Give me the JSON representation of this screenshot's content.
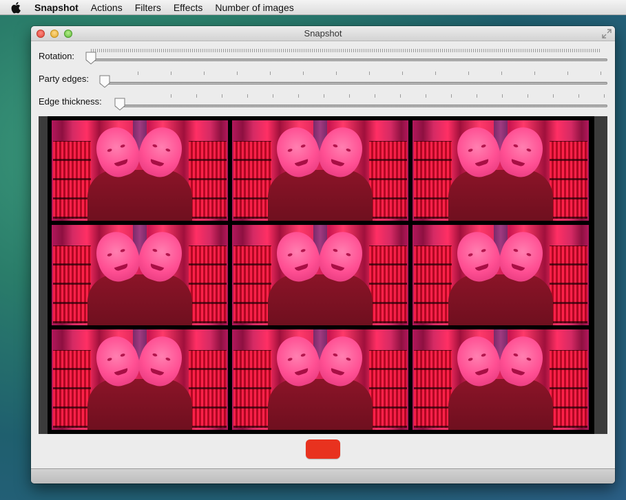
{
  "menubar": {
    "apple_icon": "apple-icon",
    "app_name": "Snapshot",
    "items": [
      "Actions",
      "Filters",
      "Effects",
      "Number of images"
    ]
  },
  "window": {
    "title": "Snapshot"
  },
  "controls": {
    "rotation_label": "Rotation:",
    "rotation_value": 0,
    "party_edges_label": "Party edges:",
    "party_edges_value": 0,
    "edge_thickness_label": "Edge thickness:",
    "edge_thickness_value": 0
  },
  "grid": {
    "rows": 3,
    "columns": 3,
    "tile_count": 9
  },
  "snapshot_button": {
    "color": "#e8321f"
  },
  "colors": {
    "accent": "#ff2f64",
    "window_bg": "#ececec"
  }
}
